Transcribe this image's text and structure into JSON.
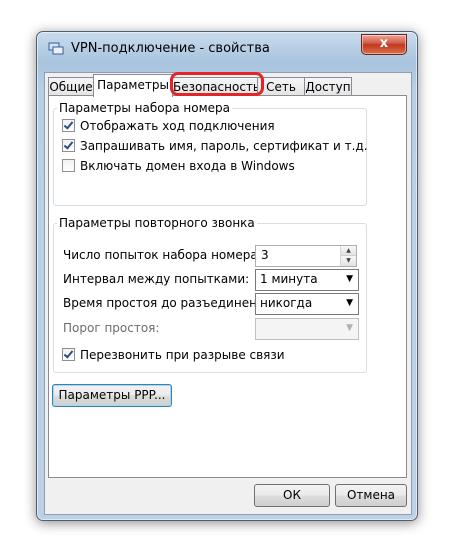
{
  "window": {
    "title": "VPN-подключение - свойства",
    "close_label": "x"
  },
  "tabs": [
    {
      "label": "Общие"
    },
    {
      "label": "Параметры"
    },
    {
      "label": "Безопасность"
    },
    {
      "label": "Сеть"
    },
    {
      "label": "Доступ"
    }
  ],
  "dial_group": {
    "title": "Параметры набора номера",
    "options": [
      {
        "label": "Отображать ход подключения",
        "checked": true
      },
      {
        "label": "Запрашивать имя, пароль, сертификат и т.д.",
        "checked": true
      },
      {
        "label": "Включать домен входа в Windows",
        "checked": false
      }
    ]
  },
  "redial_group": {
    "title": "Параметры повторного звонка",
    "attempts_label": "Число попыток набора номера:",
    "attempts_value": "3",
    "interval_label": "Интервал между попытками:",
    "interval_value": "1 минута",
    "idle_label": "Время простоя до разъединения:",
    "idle_value": "никогда",
    "threshold_label": "Порог простоя:",
    "threshold_value": "",
    "redial_check_label": "Перезвонить при разрыве связи",
    "redial_checked": true
  },
  "ppp_button": "Параметры PPP...",
  "footer": {
    "ok": "ОК",
    "cancel": "Отмена"
  },
  "colors": {
    "highlight": "#e32525",
    "close_button": "#c2371f",
    "frame": "#bcd1e6"
  }
}
